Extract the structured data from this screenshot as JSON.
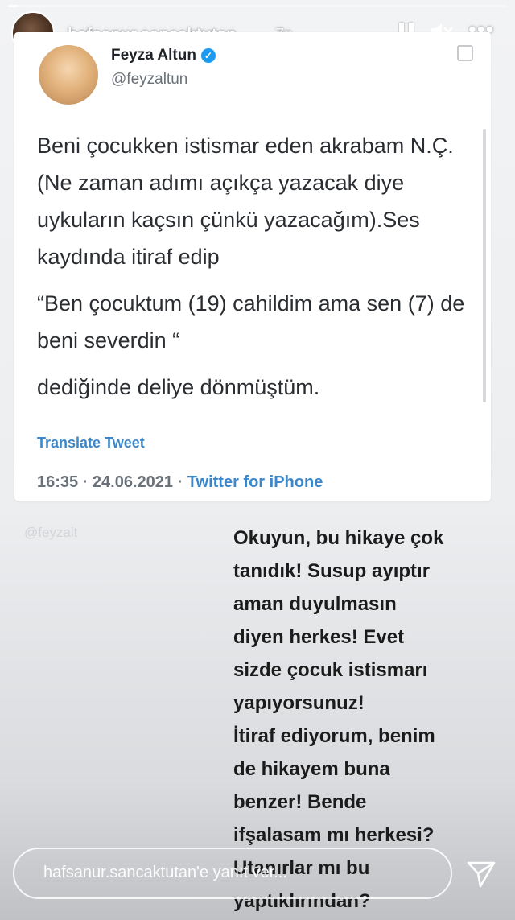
{
  "story": {
    "progress": 0.02,
    "username": "hafsanur.sancaktutan",
    "time_ago": "7s",
    "icons": [
      "pause-icon",
      "mute-icon",
      "more-icon"
    ]
  },
  "tweet": {
    "author_name": "Feyza Altun",
    "handle": "@feyzaltun",
    "verified": true,
    "paragraph1": "Beni çocukken istismar eden akrabam N.Ç.  (Ne zaman adımı açıkça yazacak diye uykuların kaçsın çünkü yazacağım).Ses kaydında itiraf edip",
    "paragraph2": " “Ben çocuktum (19) cahildim ama sen (7) de beni severdin “",
    "paragraph3": "dediğinde deliye dönmüştüm.",
    "translate_label": "Translate Tweet",
    "timestamp": "16:35 · 24.06.2021 · ",
    "source": "Twitter for iPhone",
    "link_color": "#3d87c9"
  },
  "watermark": "@feyzalt",
  "caption": "Okuyun, bu hikaye çok\ntanıdık! Susup ayıptır\naman duyulmasın\ndiyen herkes! Evet\nsizde çocuk istismarı\nyapıyorsunuz!\nİtiraf ediyorum, benim\nde hikayem buna\nbenzer! Bende\nifşalasam mı herkesi?\nUtanırlar mı bu\nyaptıklırından?",
  "reply": {
    "placeholder": "hafsanur.sancaktutan'e yanıt ver..."
  }
}
